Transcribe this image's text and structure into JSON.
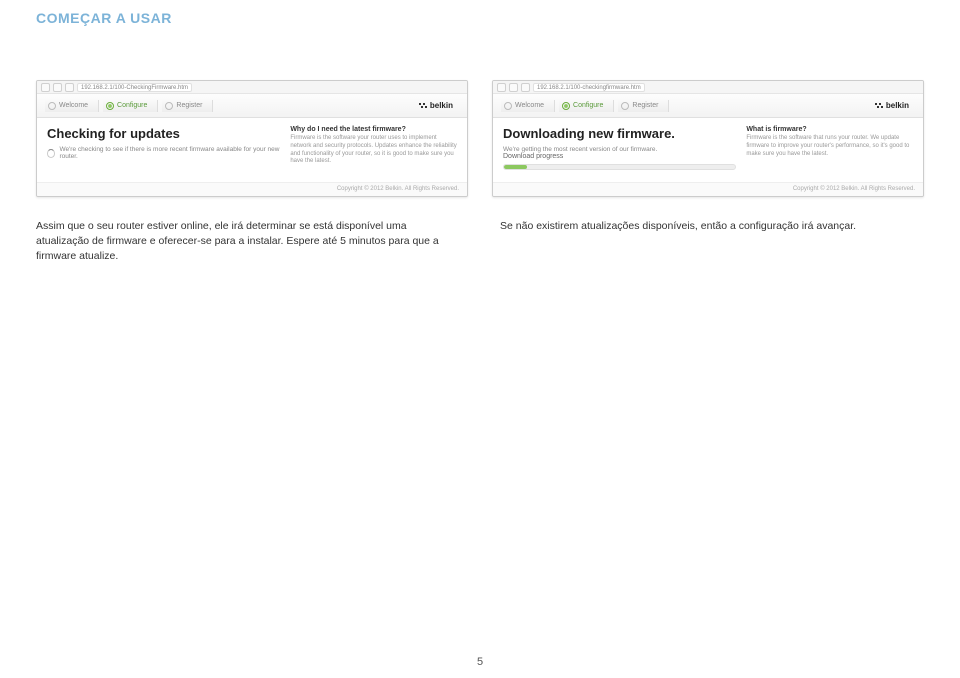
{
  "page_title": "COMEÇAR A USAR",
  "page_number": "5",
  "screenshots": {
    "left": {
      "url": "192.168.2.1/100-CheckingFirmware.htm",
      "tab_welcome": "Welcome",
      "tab_configure": "Configure",
      "tab_register": "Register",
      "brand": "belkin",
      "heading": "Checking for updates",
      "status_text": "We're checking to see if there is more recent firmware available for your new router.",
      "side_heading": "Why do I need the latest firmware?",
      "side_text": "Firmware is the software your router uses to implement network and security protocols. Updates enhance the reliability and functionality of your router, so it is good to make sure you have the latest.",
      "footer_text": "Copyright © 2012  Belkin. All Rights Reserved."
    },
    "right": {
      "url": "192.168.2.1/100-checkingfirmware.htm",
      "tab_welcome": "Welcome",
      "tab_configure": "Configure",
      "tab_register": "Register",
      "brand": "belkin",
      "heading": "Downloading new firmware.",
      "status_text": "We're getting the most recent version of our firmware.",
      "progress_label": "Download progress",
      "side_heading": "What is firmware?",
      "side_text": "Firmware is the software that runs your router. We update firmware to improve your router's performance, so it's good to make sure you have the latest.",
      "footer_text": "Copyright © 2012  Belkin. All Rights Reserved."
    }
  },
  "body": {
    "left_paragraph": "Assim que o seu router estiver online, ele irá determinar se está disponível uma atualização de firmware e oferecer-se para a instalar. Espere até 5 minutos para que a firmware atualize.",
    "right_paragraph": "Se não existirem atualizações disponíveis, então a configuração irá avançar."
  }
}
